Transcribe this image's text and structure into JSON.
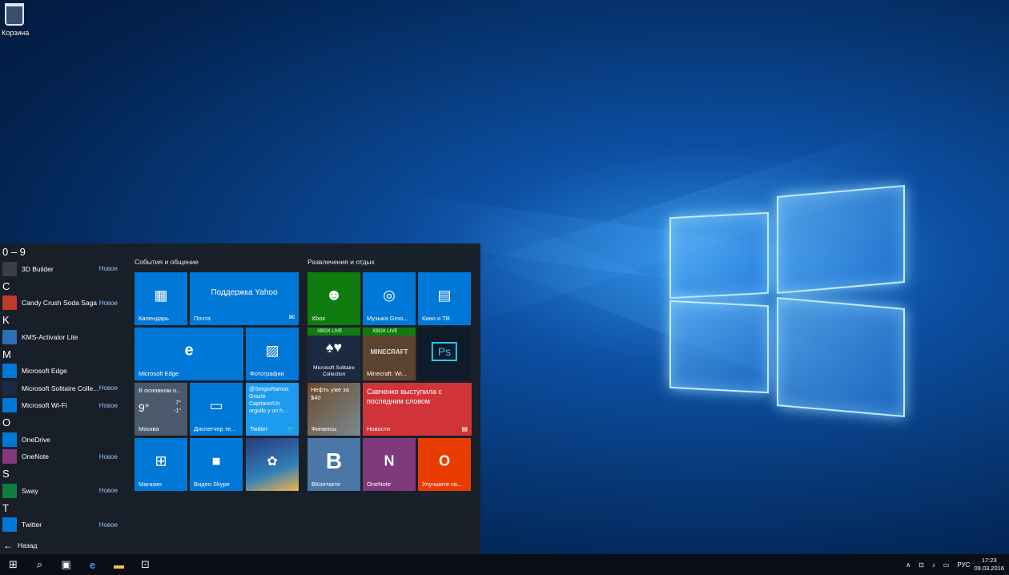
{
  "desktop": {
    "recycle_bin_label": "Корзина"
  },
  "start": {
    "applist": [
      {
        "type": "letter",
        "text": "0 – 9"
      },
      {
        "type": "app",
        "label": "3D Builder",
        "badge": "Новое",
        "icon": "3d-builder-icon",
        "color": "#3a3f47"
      },
      {
        "type": "letter",
        "text": "C"
      },
      {
        "type": "app",
        "label": "Candy Crush Soda Saga",
        "badge": "Новое",
        "icon": "candy-crush-icon",
        "color": "#c0392b"
      },
      {
        "type": "letter",
        "text": "K"
      },
      {
        "type": "app",
        "label": "KMS-Activator Lite",
        "badge": "",
        "icon": "kms-activator-icon",
        "color": "#2c6fb5"
      },
      {
        "type": "letter",
        "text": "M"
      },
      {
        "type": "app",
        "label": "Microsoft Edge",
        "badge": "",
        "icon": "edge-icon",
        "color": "#0078d7"
      },
      {
        "type": "app",
        "label": "Microsoft Solitaire Colle...",
        "badge": "Новое",
        "icon": "solitaire-icon",
        "color": "#1b2a40"
      },
      {
        "type": "app",
        "label": "Microsoft Wi-Fi",
        "badge": "Новое",
        "icon": "wifi-icon",
        "color": "#0078d7"
      },
      {
        "type": "letter",
        "text": "O"
      },
      {
        "type": "app",
        "label": "OneDrive",
        "badge": "",
        "icon": "onedrive-icon",
        "color": "#0078d7"
      },
      {
        "type": "app",
        "label": "OneNote",
        "badge": "Новое",
        "icon": "onenote-icon",
        "color": "#80397b"
      },
      {
        "type": "letter",
        "text": "S"
      },
      {
        "type": "app",
        "label": "Sway",
        "badge": "Новое",
        "icon": "sway-icon",
        "color": "#107c41"
      },
      {
        "type": "letter",
        "text": "T"
      },
      {
        "type": "app",
        "label": "Twitter",
        "badge": "Новое",
        "icon": "twitter-icon",
        "color": "#0078d7"
      }
    ],
    "back_label": "Назад",
    "group1_title": "События и общение",
    "group2_title": "Развлечения и отдых",
    "tiles": {
      "calendar": "Календарь",
      "mail_title": "Поддержка Yahoo",
      "mail": "Почта",
      "edge": "Microsoft Edge",
      "photos": "Фотографии",
      "weather_header": "В основном о...",
      "weather_temp": "9°",
      "weather_hi": "7°",
      "weather_lo": "-1°",
      "weather_city": "Москва",
      "devices": "Диспетчер те...",
      "twitter_text": "@SergioRamos Grazie Capitano!Un orgullo y un h...",
      "twitter": "Twitter",
      "store": "Магазин",
      "skype": "Видео Skype",
      "xbox": "Xbox",
      "groove": "Музыка Groo...",
      "movies": "Кино и ТВ",
      "xboxlive1": "XBOX LIVE",
      "xboxlive2": "XBOX LIVE",
      "solitaire": "Microsoft Solitaire Collection",
      "minecraft_logo": "MINECRAFT",
      "minecraft": "Minecraft: Wi...",
      "ps_glyph": "Ps",
      "finance_text": "Нефть уже за $40",
      "finance": "Финансы",
      "news_text": "Савченко выступила с последним словом",
      "news": "Новости",
      "vk_glyph": "B",
      "vk": "ВКонтакте",
      "onenote_glyph": "N",
      "onenote": "OneNote",
      "office_glyph": "O",
      "office": "Улучшите св..."
    }
  },
  "taskbar": {
    "language": "РУС",
    "time": "17:23",
    "date": "09.03.2016"
  }
}
